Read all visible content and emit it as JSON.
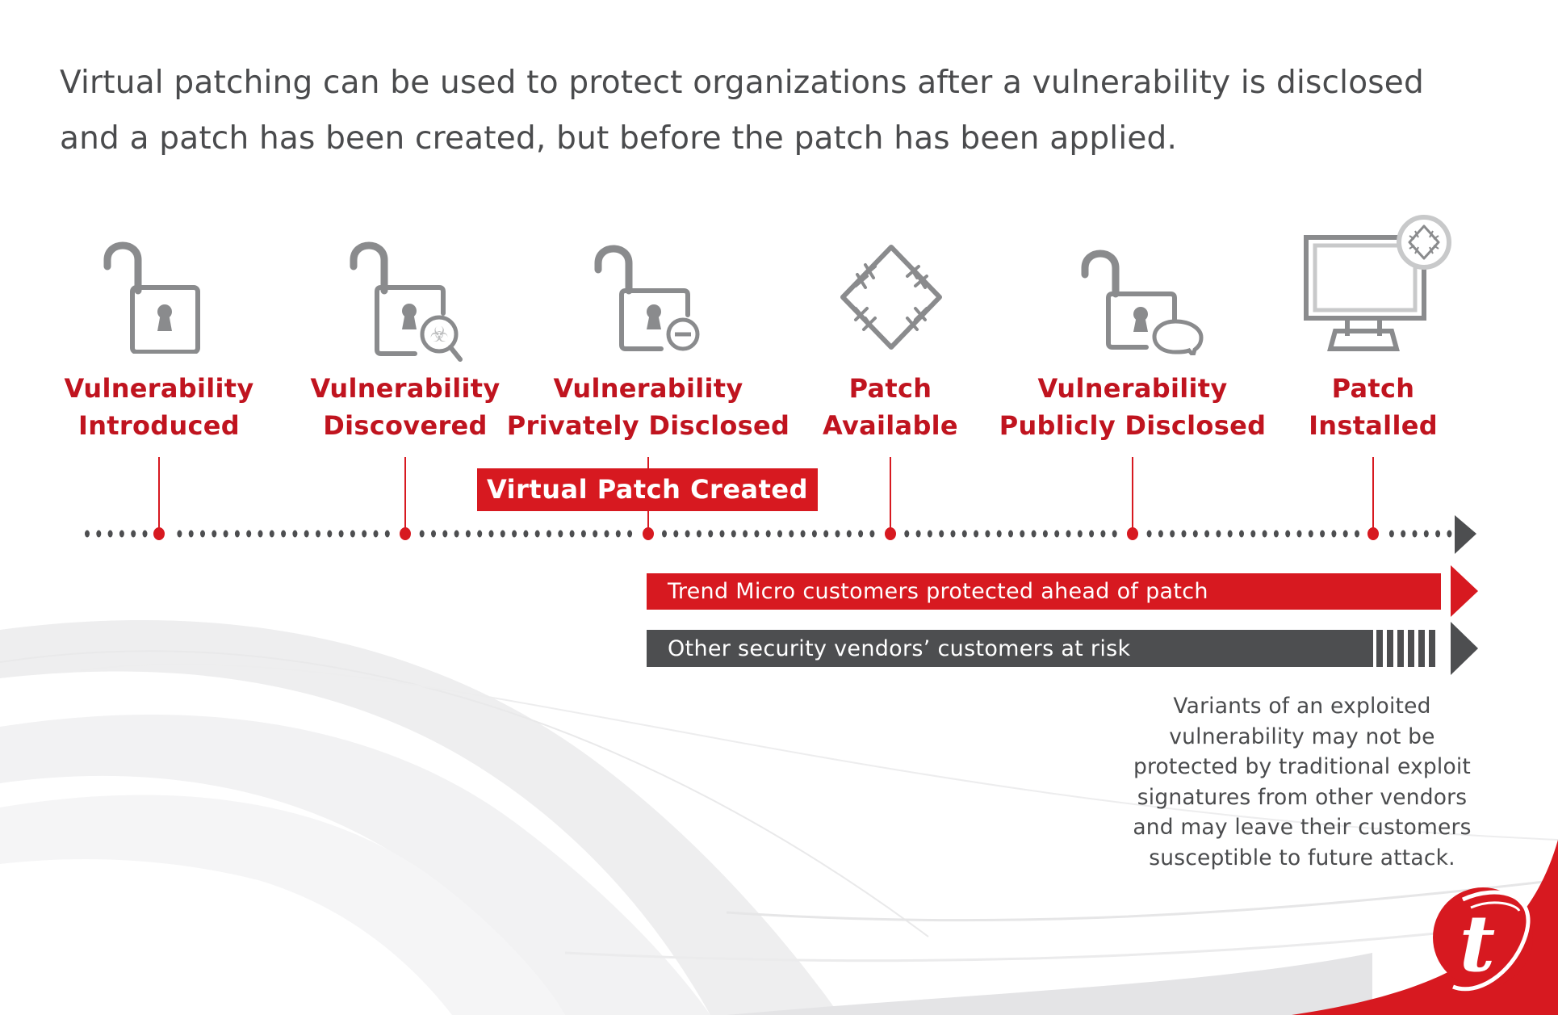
{
  "heading": {
    "line1": "Virtual patching can be used to protect organizations after a vulnerability is disclosed",
    "line2": "and a patch has been created, but before the patch has been applied."
  },
  "colors": {
    "brand_red": "#d71920",
    "label_red": "#c0141f",
    "dark_gray": "#4d4e50",
    "icon_gray": "#8a8b8d",
    "icon_light_gray": "#c8c9ca",
    "text_gray": "#4a4b4d"
  },
  "milestones": [
    {
      "line1": "Vulnerability",
      "line2": "Introduced",
      "icon": "unlocked-padlock-icon"
    },
    {
      "line1": "Vulnerability",
      "line2": "Discovered",
      "icon": "padlock-biohazard-magnifier-icon"
    },
    {
      "line1": "Vulnerability",
      "line2": "Privately Disclosed",
      "icon": "padlock-minus-icon"
    },
    {
      "line1": "Patch",
      "line2": "Available",
      "icon": "patch-bandage-icon"
    },
    {
      "line1": "Vulnerability",
      "line2": "Publicly Disclosed",
      "icon": "padlock-speech-bubble-icon"
    },
    {
      "line1": "Patch",
      "line2": "Installed",
      "icon": "monitor-patch-icon"
    }
  ],
  "virtual_patch_label": "Virtual Patch Created",
  "bars": {
    "trend": "Trend Micro customers protected ahead of patch",
    "others": "Other security vendors’ customers at risk"
  },
  "note": [
    "Variants of an exploited",
    "vulnerability may not be",
    "protected by traditional exploit",
    "signatures from other vendors",
    "and may leave their customers",
    "susceptible to future attack."
  ],
  "logo": "trend-micro-logo"
}
